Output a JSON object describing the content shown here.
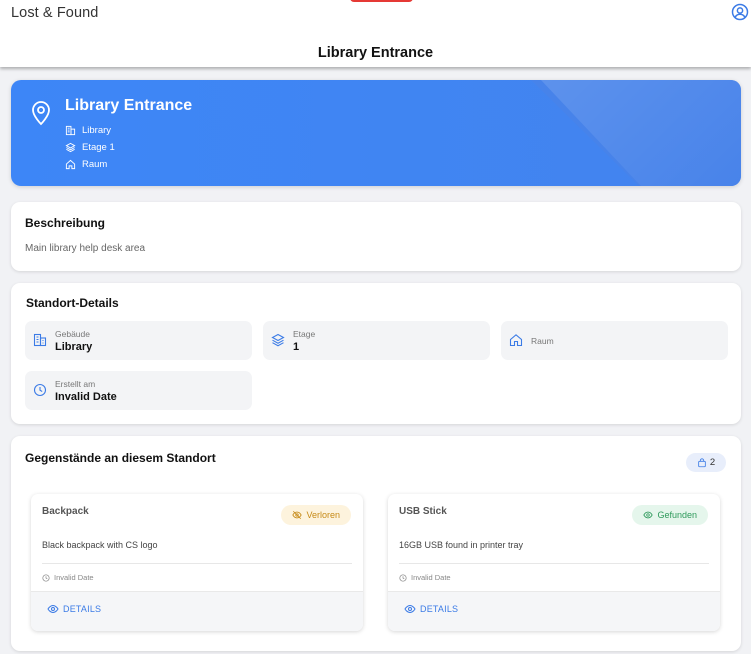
{
  "app": {
    "name": "Lost & Found",
    "page_title": "Library Entrance"
  },
  "hero": {
    "title": "Library Entrance",
    "building": "Library",
    "floor": "Etage 1",
    "room": "Raum"
  },
  "description": {
    "title": "Beschreibung",
    "text": "Main library help desk area"
  },
  "details": {
    "title": "Standort-Details",
    "building_label": "Gebäude",
    "building_value": "Library",
    "floor_label": "Etage",
    "floor_value": "1",
    "room_label": "Raum",
    "created_label": "Erstellt am",
    "created_value": "Invalid Date"
  },
  "items_section": {
    "title": "Gegenstände an diesem Standort",
    "count": "2",
    "items": [
      {
        "name": "Backpack",
        "status": "Verloren",
        "description": "Black backpack with CS logo",
        "date": "Invalid Date",
        "action": "DETAILS"
      },
      {
        "name": "USB Stick",
        "status": "Gefunden",
        "description": "16GB USB found in printer tray",
        "date": "Invalid Date",
        "action": "DETAILS"
      }
    ]
  },
  "colors": {
    "primary": "#3d86f7",
    "lost": "#c68a17",
    "found": "#2f9a5c",
    "link": "#3b7be6"
  },
  "icons": [
    "user-circle-icon",
    "map-pin-icon",
    "building-icon",
    "layers-icon",
    "home-icon",
    "clock-icon",
    "bag-icon",
    "eye-off-icon",
    "eye-icon"
  ]
}
